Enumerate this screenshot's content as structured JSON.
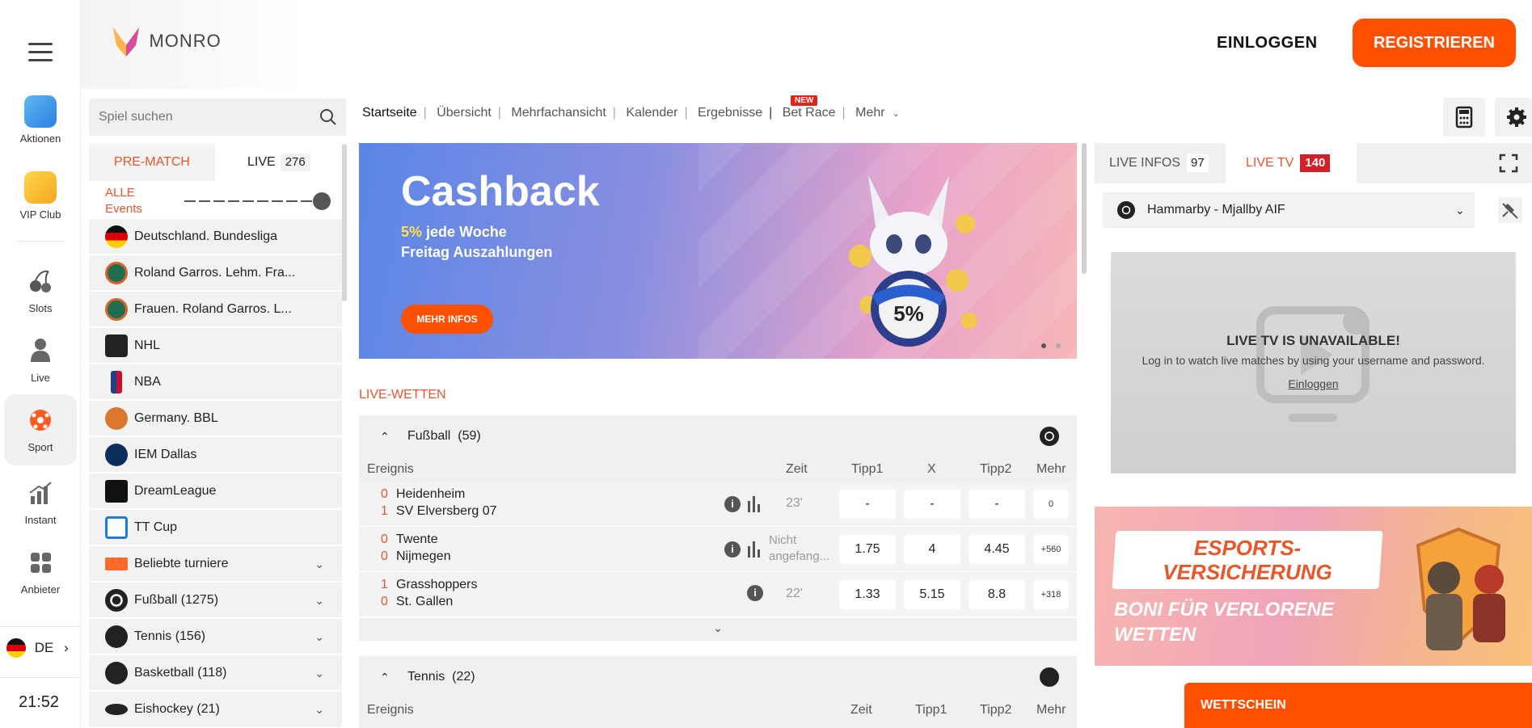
{
  "rail": {
    "items": [
      {
        "label": "Aktionen",
        "icon": "megaphone-icon"
      },
      {
        "label": "VIP Club",
        "icon": "crown-icon"
      },
      {
        "label": "Slots",
        "icon": "cherry-icon"
      },
      {
        "label": "Live",
        "icon": "person-icon"
      },
      {
        "label": "Sport",
        "icon": "soccer-ball-icon"
      },
      {
        "label": "Instant",
        "icon": "bar-chart-icon"
      },
      {
        "label": "Anbieter",
        "icon": "grid-icon"
      }
    ],
    "language": "DE",
    "clock": "21:52"
  },
  "header": {
    "brand": "MONRO",
    "login": "EINLOGGEN",
    "register": "REGISTRIEREN"
  },
  "search": {
    "placeholder": "Spiel suchen"
  },
  "tabs": {
    "prematch": "PRE-MATCH",
    "live": "LIVE",
    "live_count": "276"
  },
  "filter": {
    "line1": "ALLE",
    "line2": "Events"
  },
  "leagues": [
    {
      "label": "Deutschland. Bundesliga",
      "icon": "germany-flag-icon"
    },
    {
      "label": "Roland Garros. Lehm. Fra...",
      "icon": "roland-garros-icon"
    },
    {
      "label": "Frauen. Roland Garros. L...",
      "icon": "roland-garros-icon"
    },
    {
      "label": "NHL",
      "icon": "nhl-logo-icon"
    },
    {
      "label": "NBA",
      "icon": "nba-logo-icon"
    },
    {
      "label": "Germany. BBL",
      "icon": "basketball-icon"
    },
    {
      "label": "IEM Dallas",
      "icon": "iem-logo-icon"
    },
    {
      "label": "DreamLeague",
      "icon": "dreamleague-logo-icon"
    },
    {
      "label": "TT Cup",
      "icon": "tt-cup-logo-icon"
    }
  ],
  "sports": [
    {
      "label": "Beliebte turniere",
      "icon": "podium-icon"
    },
    {
      "label": "Fußball (1275)",
      "icon": "soccer-ball-icon"
    },
    {
      "label": "Tennis (156)",
      "icon": "tennis-ball-icon"
    },
    {
      "label": "Basketball (118)",
      "icon": "basketball-icon"
    },
    {
      "label": "Eishockey (21)",
      "icon": "hockey-puck-icon"
    }
  ],
  "nav": {
    "items": [
      "Startseite",
      "Übersicht",
      "Mehrfachansicht",
      "Kalender",
      "Ergebnisse",
      "Bet Race",
      "Mehr"
    ],
    "new_badge": "NEW"
  },
  "banner": {
    "title": "Cashback",
    "highlight": "5%",
    "line1": " jede Woche",
    "line2": "Freitag Auszahlungen",
    "button": "MEHR INFOS",
    "coin_text": "5%"
  },
  "live": {
    "section_title": "LIVE-WETTEN",
    "football": {
      "name": "Fußball",
      "count": "(59)"
    },
    "headers": {
      "event": "Ereignis",
      "time": "Zeit",
      "t1": "Tipp1",
      "x": "X",
      "t2": "Tipp2",
      "more": "Mehr"
    },
    "matches": [
      {
        "s1": "0",
        "team1": "Heidenheim",
        "s2": "1",
        "team2": "SV Elversberg 07",
        "time": "23'",
        "o1": "-",
        "ox": "-",
        "o2": "-",
        "more": "0"
      },
      {
        "s1": "0",
        "team1": "Twente",
        "s2": "0",
        "team2": "Nijmegen",
        "time": "Nicht angefang...",
        "o1": "1.75",
        "ox": "4",
        "o2": "4.45",
        "more": "+560"
      },
      {
        "s1": "1",
        "team1": "Grasshoppers",
        "s2": "0",
        "team2": "St. Gallen",
        "time": "22'",
        "o1": "1.33",
        "ox": "5.15",
        "o2": "8.8",
        "more": "+318"
      }
    ],
    "tennis": {
      "name": "Tennis",
      "count": "(22)"
    },
    "tennis_headers": {
      "event": "Ereignis",
      "time": "Zeit",
      "t1": "Tipp1",
      "t2": "Tipp2",
      "more": "Mehr"
    }
  },
  "right": {
    "live_infos": "LIVE INFOS",
    "live_infos_count": "97",
    "live_tv": "LIVE TV",
    "live_tv_count": "140",
    "match_select": "Hammarby - Mjallby AIF",
    "tv_title": "LIVE TV IS UNAVAILABLE!",
    "tv_text": "Log in to watch live matches by using your username and password.",
    "tv_link": "Einloggen",
    "promo_title1": "ESPORTS-",
    "promo_title2": "VERSICHERUNG",
    "promo_sub1": "BONI FÜR VERLORENE",
    "promo_sub2": "WETTEN",
    "betslip": "WETTSCHEIN"
  },
  "colors": {
    "accent": "#ff4f00",
    "live_red": "#e8562a",
    "tv_badge": "#d31f2a"
  }
}
